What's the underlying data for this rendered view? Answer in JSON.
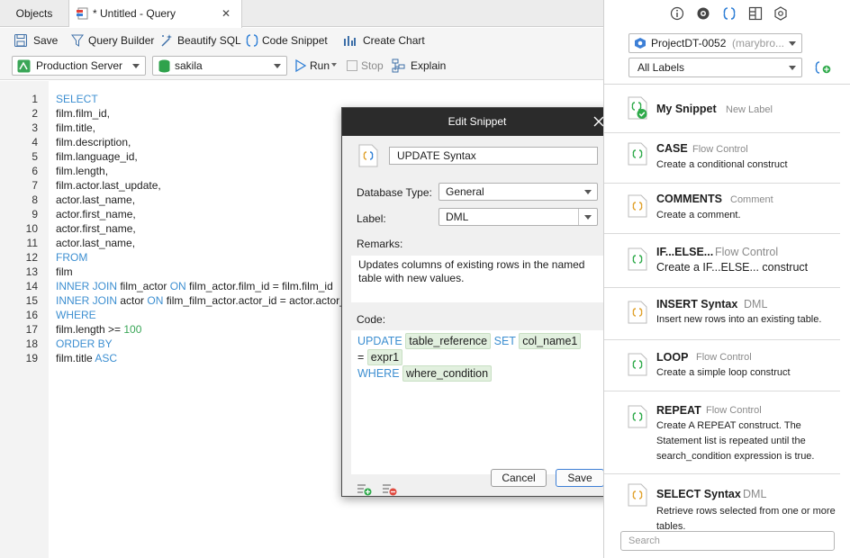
{
  "tabs": {
    "objects": "Objects",
    "query": "* Untitled - Query"
  },
  "toolbar": {
    "save": "Save",
    "query_builder": "Query Builder",
    "beautify": "Beautify SQL",
    "code_snippet": "Code Snippet",
    "create_chart": "Create Chart",
    "connection": "Production Server",
    "database": "sakila",
    "run": "Run",
    "stop": "Stop",
    "explain": "Explain"
  },
  "editor": {
    "lines": [
      {
        "n": "1",
        "t": "SELECT"
      },
      {
        "n": "2",
        "t": "film.film_id,"
      },
      {
        "n": "3",
        "t": "film.title,"
      },
      {
        "n": "4",
        "t": "film.description,"
      },
      {
        "n": "5",
        "t": "film.language_id,"
      },
      {
        "n": "6",
        "t": "film.length,"
      },
      {
        "n": "7",
        "t": "film.actor.last_update,"
      },
      {
        "n": "8",
        "t": "actor.last_name,"
      },
      {
        "n": "9",
        "t": "actor.first_name,"
      },
      {
        "n": "10",
        "t": "actor.first_name,"
      },
      {
        "n": "11",
        "t": "actor.last_name,"
      },
      {
        "n": "12",
        "t": "FROM"
      },
      {
        "n": "13",
        "t": "film"
      },
      {
        "n": "14",
        "kw1": "INNER JOIN",
        "t1": " film_actor ",
        "kw2": "ON",
        "t2": " film_actor.film_id = film.film_id"
      },
      {
        "n": "15",
        "kw1": "INNER JOIN",
        "t1": " actor ",
        "kw2": "ON",
        "t2": " film_film_actor.actor_id = actor.actor_id"
      },
      {
        "n": "16",
        "t": "WHERE"
      },
      {
        "n": "17",
        "t": "film.length >= ",
        "num": "100"
      },
      {
        "n": "18",
        "t": "ORDER BY"
      },
      {
        "n": "19",
        "t": "film.title ",
        "kw": "ASC"
      }
    ]
  },
  "dialog": {
    "title": "Edit Snippet",
    "name_value": "UPDATE Syntax",
    "db_type_label": "Database Type:",
    "db_type_value": "General",
    "label_label": "Label:",
    "label_value": "DML",
    "remarks_label": "Remarks:",
    "remarks_text": "Updates columns of existing rows in the named table with new values.",
    "code_label": "Code:",
    "code": {
      "kw_update": "UPDATE",
      "ph_table": "table_reference",
      "kw_set": "SET",
      "ph_col": "col_name1",
      "eq": "=",
      "ph_expr": "expr1",
      "kw_where": "WHERE",
      "ph_where": "where_condition"
    },
    "cancel": "Cancel",
    "save": "Save"
  },
  "right_panel": {
    "project": "ProjectDT-0052",
    "project_owner": "(marybro...",
    "labels_filter": "All Labels",
    "search_placeholder": "Search",
    "snippets": [
      {
        "name": "My Snippet",
        "label": "New Label",
        "desc": ""
      },
      {
        "name": "CASE",
        "label": "Flow Control",
        "desc": "Create a conditional construct"
      },
      {
        "name": "COMMENTS",
        "label": "Comment",
        "desc": "Create a comment."
      },
      {
        "name": "IF...ELSE...",
        "label": "Flow Control",
        "desc": "Create a IF...ELSE... construct"
      },
      {
        "name": "INSERT Syntax",
        "label": "DML",
        "desc": "Insert new rows into an existing table."
      },
      {
        "name": "LOOP",
        "label": "Flow Control",
        "desc": "Create a simple loop construct"
      },
      {
        "name": "REPEAT",
        "label": "Flow Control",
        "desc": "Create A REPEAT construct. The Statement list is repeated until the search_condition expression is true."
      },
      {
        "name": "SELECT Syntax",
        "label": "DML",
        "desc": "Retrieve rows selected from one or more tables."
      }
    ]
  },
  "colors": {
    "keyword": "#3d8fd1",
    "number": "#3aa657",
    "dialog_title_bg": "#2b2b2b",
    "snippet_accent": "#2eaa4a"
  }
}
